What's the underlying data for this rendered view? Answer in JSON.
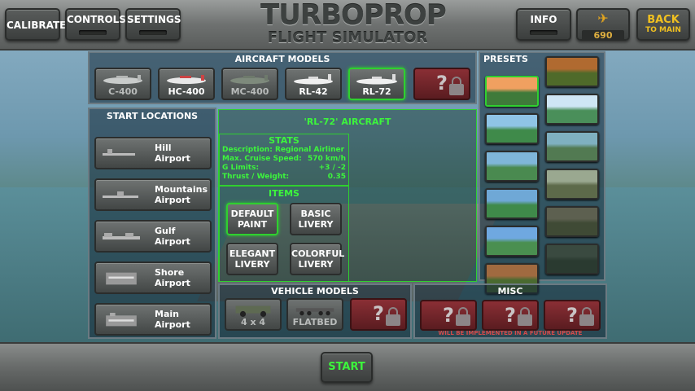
{
  "top": {
    "calibrate": "CALIBRATE",
    "controls": "CONTROLS",
    "settings": "SETTINGS",
    "title_line1": "TURBOPROP",
    "title_line2": "FLIGHT SIMULATOR",
    "info": "INFO",
    "coins": "690",
    "back_line1": "BACK",
    "back_line2": "TO MAIN"
  },
  "aircraft": {
    "title": "AIRCRAFT MODELS",
    "models": [
      {
        "label": "C-400",
        "selected": false
      },
      {
        "label": "HC-400",
        "selected": false
      },
      {
        "label": "MC-400",
        "selected": false
      },
      {
        "label": "RL-42",
        "selected": false
      },
      {
        "label": "RL-72",
        "selected": true
      }
    ],
    "locked_symbol": "?"
  },
  "locations": {
    "title": "START LOCATIONS",
    "items": [
      {
        "line1": "Hill",
        "line2": "Airport"
      },
      {
        "line1": "Mountains",
        "line2": "Airport"
      },
      {
        "line1": "Gulf",
        "line2": "Airport"
      },
      {
        "line1": "Shore",
        "line2": "Airport"
      },
      {
        "line1": "Main",
        "line2": "Airport"
      }
    ]
  },
  "details": {
    "aircraft_name": "'RL-72' AIRCRAFT",
    "stats_title": "STATS",
    "stats": [
      {
        "key": "Description:",
        "value": "Regional Airliner"
      },
      {
        "key": "Max. Cruise Speed:",
        "value": "570 km/h"
      },
      {
        "key": "G Limits:",
        "value": "+3 / -2"
      },
      {
        "key": "Thrust / Weight:",
        "value": "0.35"
      }
    ],
    "items_title": "ITEMS",
    "items": [
      {
        "line1": "DEFAULT",
        "line2": "PAINT",
        "selected": true
      },
      {
        "line1": "BASIC",
        "line2": "LIVERY",
        "selected": false
      },
      {
        "line1": "ELEGANT",
        "line2": "LIVERY",
        "selected": false
      },
      {
        "line1": "COLORFUL",
        "line2": "LIVERY",
        "selected": false
      }
    ]
  },
  "presets": {
    "title": "PRESETS",
    "count": 12
  },
  "vehicles": {
    "title": "VEHICLE MODELS",
    "models": [
      {
        "label": "4 x 4"
      },
      {
        "label": "FLATBED"
      }
    ],
    "locked_symbol": "?"
  },
  "misc": {
    "title": "MISC",
    "locked_symbol": "?",
    "notice": "WILL BE IMPLEMENTED IN A FUTURE UPDATE"
  },
  "start": "START",
  "colors": {
    "accent_green": "#3cf53c",
    "coin_gold": "#e3a51e",
    "back_yellow": "#f0c020",
    "locked_red": "#8a2f35"
  }
}
